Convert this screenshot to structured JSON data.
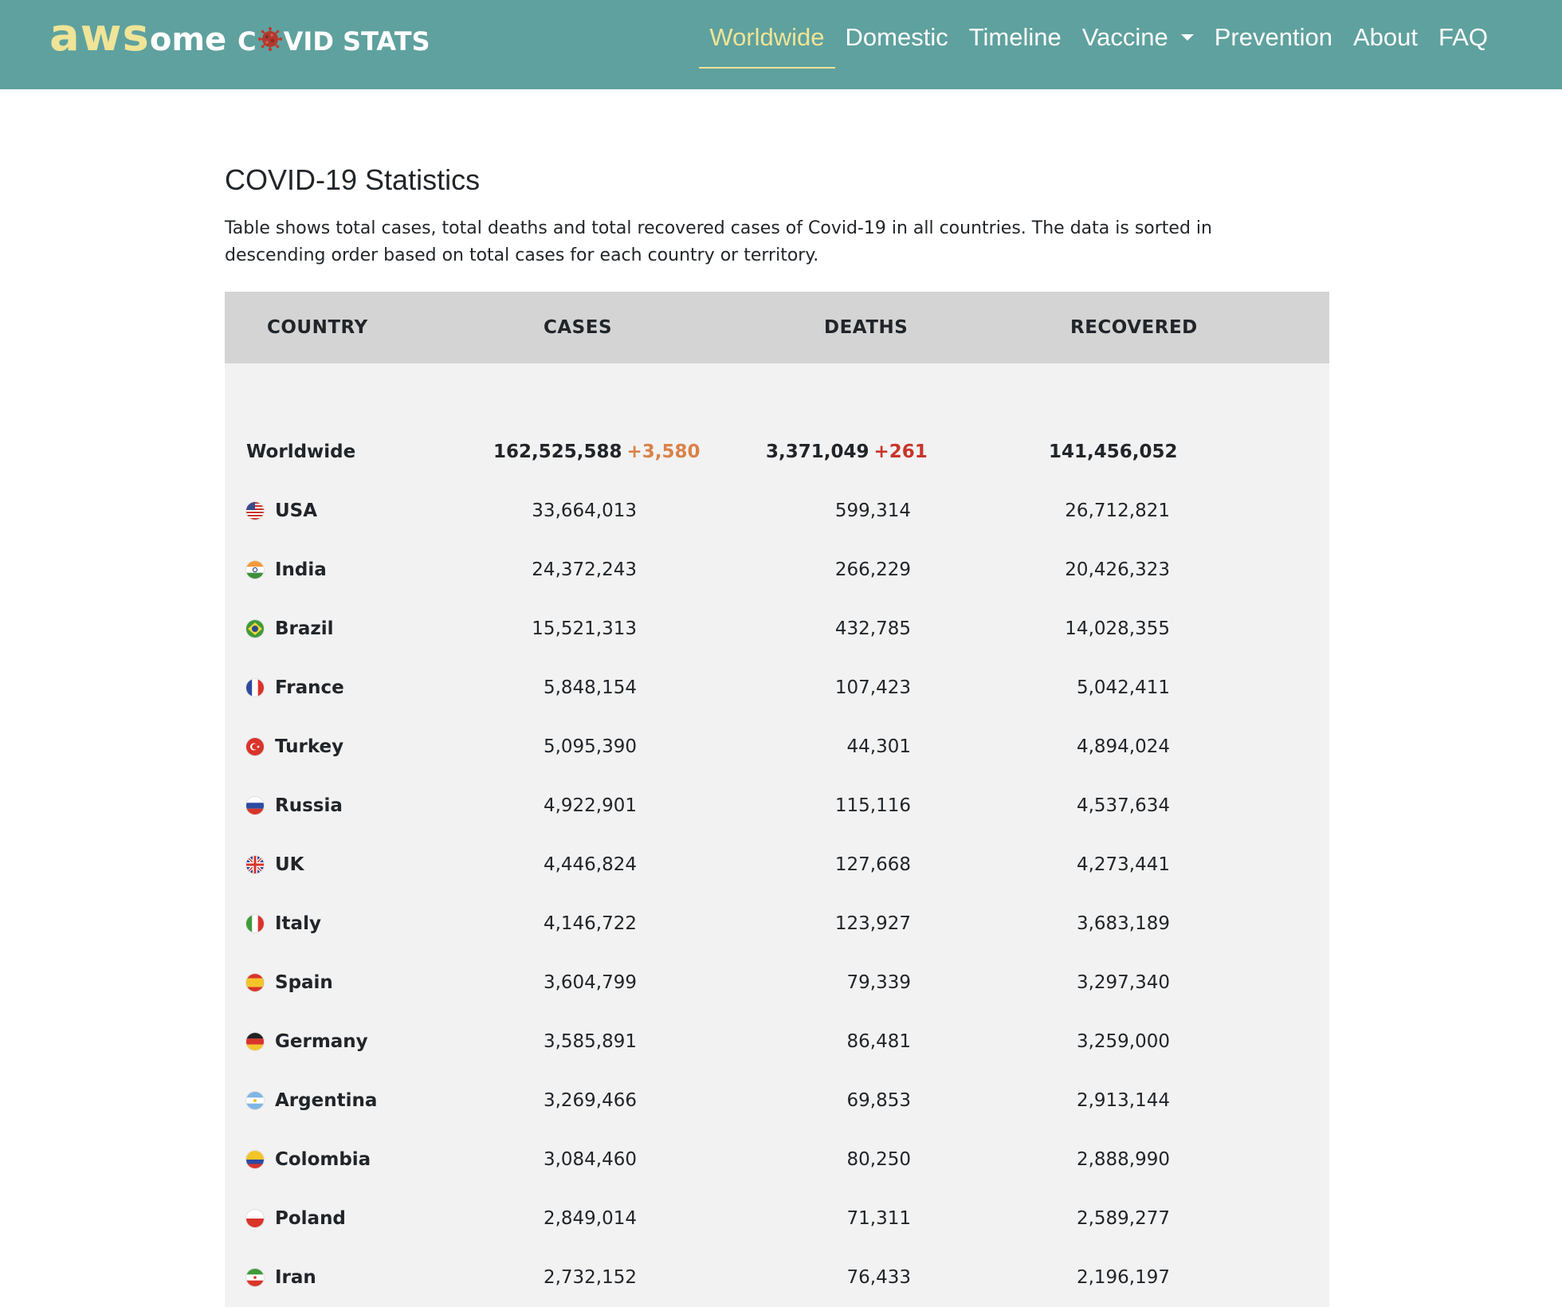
{
  "brand": {
    "aws": "aws",
    "ome": "ome",
    "c": "C",
    "rest": "VID STATS",
    "virus_icon": "coronavirus-icon"
  },
  "nav": {
    "items": [
      {
        "label": "Worldwide",
        "active": true
      },
      {
        "label": "Domestic",
        "active": false
      },
      {
        "label": "Timeline",
        "active": false
      },
      {
        "label": "Vaccine",
        "active": false,
        "dropdown": true
      },
      {
        "label": "Prevention",
        "active": false
      },
      {
        "label": "About",
        "active": false
      },
      {
        "label": "FAQ",
        "active": false
      }
    ]
  },
  "colors": {
    "navbar_bg": "#5fa19e",
    "brand_accent": "#efe497",
    "header_row_bg": "#d4d4d4",
    "table_bg": "#f2f2f2",
    "delta_cases": "#d9824a",
    "delta_deaths": "#c8352a"
  },
  "page": {
    "title": "COVID-19 Statistics",
    "description": "Table shows total cases, total deaths and total recovered cases of Covid-19 in all countries. The data is sorted in descending order based on total cases for each country or territory."
  },
  "table": {
    "headers": {
      "country": "COUNTRY",
      "cases": "CASES",
      "deaths": "DEATHS",
      "recovered": "RECOVERED"
    },
    "worldwide": {
      "country": "Worldwide",
      "cases": "162,525,588",
      "cases_delta": "+3,580",
      "deaths": "3,371,049",
      "deaths_delta": "+261",
      "recovered": "141,456,052"
    },
    "rows": [
      {
        "country": "USA",
        "flag": "usa-flag-icon",
        "cases": "33,664,013",
        "deaths": "599,314",
        "recovered": "26,712,821"
      },
      {
        "country": "India",
        "flag": "india-flag-icon",
        "cases": "24,372,243",
        "deaths": "266,229",
        "recovered": "20,426,323"
      },
      {
        "country": "Brazil",
        "flag": "brazil-flag-icon",
        "cases": "15,521,313",
        "deaths": "432,785",
        "recovered": "14,028,355"
      },
      {
        "country": "France",
        "flag": "france-flag-icon",
        "cases": "5,848,154",
        "deaths": "107,423",
        "recovered": "5,042,411"
      },
      {
        "country": "Turkey",
        "flag": "turkey-flag-icon",
        "cases": "5,095,390",
        "deaths": "44,301",
        "recovered": "4,894,024"
      },
      {
        "country": "Russia",
        "flag": "russia-flag-icon",
        "cases": "4,922,901",
        "deaths": "115,116",
        "recovered": "4,537,634"
      },
      {
        "country": "UK",
        "flag": "uk-flag-icon",
        "cases": "4,446,824",
        "deaths": "127,668",
        "recovered": "4,273,441"
      },
      {
        "country": "Italy",
        "flag": "italy-flag-icon",
        "cases": "4,146,722",
        "deaths": "123,927",
        "recovered": "3,683,189"
      },
      {
        "country": "Spain",
        "flag": "spain-flag-icon",
        "cases": "3,604,799",
        "deaths": "79,339",
        "recovered": "3,297,340"
      },
      {
        "country": "Germany",
        "flag": "germany-flag-icon",
        "cases": "3,585,891",
        "deaths": "86,481",
        "recovered": "3,259,000"
      },
      {
        "country": "Argentina",
        "flag": "argentina-flag-icon",
        "cases": "3,269,466",
        "deaths": "69,853",
        "recovered": "2,913,144"
      },
      {
        "country": "Colombia",
        "flag": "colombia-flag-icon",
        "cases": "3,084,460",
        "deaths": "80,250",
        "recovered": "2,888,990"
      },
      {
        "country": "Poland",
        "flag": "poland-flag-icon",
        "cases": "2,849,014",
        "deaths": "71,311",
        "recovered": "2,589,277"
      },
      {
        "country": "Iran",
        "flag": "iran-flag-icon",
        "cases": "2,732,152",
        "deaths": "76,433",
        "recovered": "2,196,197"
      }
    ]
  }
}
